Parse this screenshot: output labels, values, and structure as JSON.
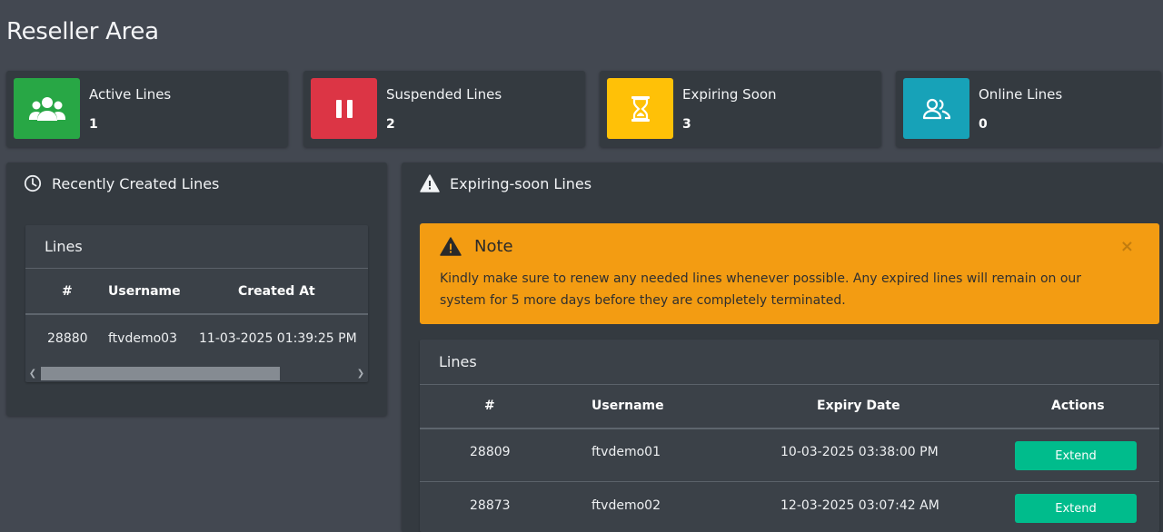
{
  "page": {
    "title": "Reseller Area"
  },
  "stats": [
    {
      "label": "Active Lines",
      "value": "1",
      "color": "#28a745",
      "icon": "users-icon"
    },
    {
      "label": "Suspended Lines",
      "value": "2",
      "color": "#dc3545",
      "icon": "pause-icon"
    },
    {
      "label": "Expiring Soon",
      "value": "3",
      "color": "#ffc107",
      "icon": "hourglass-icon"
    },
    {
      "label": "Online Lines",
      "value": "0",
      "color": "#17a2b8",
      "icon": "user-friends-icon"
    }
  ],
  "recent": {
    "header": "Recently Created Lines",
    "card_title": "Lines",
    "columns": [
      "#",
      "Username",
      "Created At"
    ],
    "rows": [
      {
        "id": "28880",
        "username": "ftvdemo03",
        "created_at": "11-03-2025 01:39:25 PM"
      }
    ]
  },
  "expiring": {
    "header": "Expiring-soon Lines",
    "alert": {
      "title": "Note",
      "text": "Kindly make sure to renew any needed lines whenever possible. Any expired lines will remain on our system for 5 more days before they are completely terminated.",
      "close": "×"
    },
    "card_title": "Lines",
    "columns": [
      "#",
      "Username",
      "Expiry Date",
      "Actions"
    ],
    "rows": [
      {
        "id": "28809",
        "username": "ftvdemo01",
        "expiry": "10-03-2025 03:38:00 PM",
        "action": "Extend"
      },
      {
        "id": "28873",
        "username": "ftvdemo02",
        "expiry": "12-03-2025 03:07:42 AM",
        "action": "Extend"
      }
    ]
  },
  "colors": {
    "background": "#434851",
    "panel": "#343a40",
    "warning": "#f39c12",
    "success": "#00bc8c"
  }
}
